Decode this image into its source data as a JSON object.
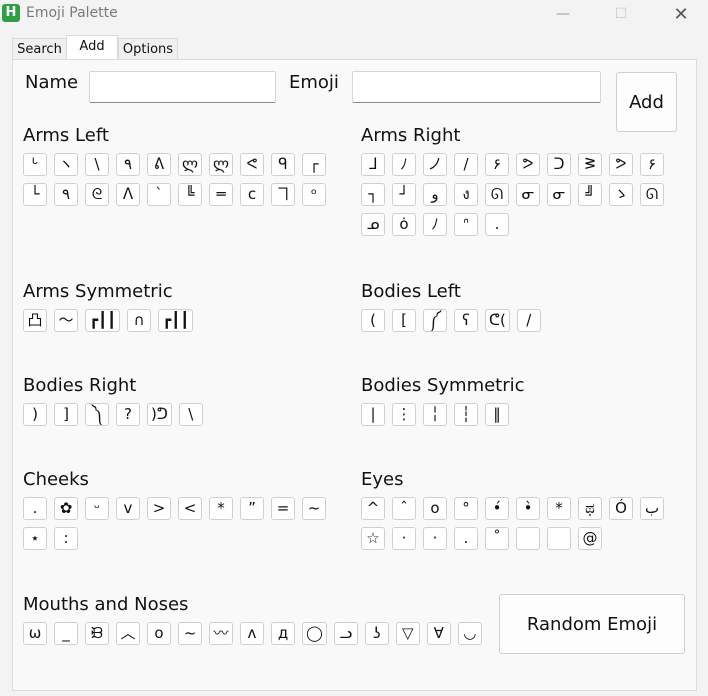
{
  "window": {
    "title": "Emoji Palette",
    "controls": {
      "minimize": "—",
      "maximize": "☐",
      "close": "✕"
    }
  },
  "tabs": [
    "Search",
    "Add",
    "Options"
  ],
  "add_form": {
    "name_label": "Name",
    "emoji_label": "Emoji",
    "name_value": "",
    "emoji_value": "",
    "add_button": "Add"
  },
  "random_button": "Random Emoji",
  "sections": [
    {
      "title": "Arms Left",
      "items": [
        "ᒡ",
        "ヽ",
        "\\",
        "٩",
        "ᕕ",
        "ლ",
        "ლ",
        "ᕙ",
        "ᑫ",
        "┌",
        "└",
        "٩",
        "ᘓ",
        "ᐱ",
        "ˋ",
        "╚",
        "═",
        "c",
        "ヿ",
        "ᵒ"
      ]
    },
    {
      "title": "Arms Right",
      "items": [
        "ᒧ",
        "ﾉ",
        "ノ",
        "/",
        "۶",
        "ᕗ",
        "ᑐ",
        "ᕒ",
        "ᕗ",
        "۶",
        "┐",
        "┘",
        "و",
        "ง",
        "ᘏ",
        "ᓂ",
        "ᓂ",
        "╝",
        "ゝ",
        "ᘏ",
        "ᓄ",
        "ȯ",
        "ﾉ",
        "ᐢ",
        "."
      ]
    },
    {
      "title": "Arms Symmetric",
      "items": [
        "凸",
        "〜",
        "┏┃┃",
        "∩",
        "┏┃┃"
      ]
    },
    {
      "title": "Bodies Left",
      "items": [
        "(",
        "[",
        "༼",
        "ʕ",
        "ᕦ(",
        "/"
      ]
    },
    {
      "title": "Bodies Right",
      "items": [
        ")",
        "]",
        "༽",
        "?",
        ")ᕤ",
        "\\"
      ]
    },
    {
      "title": "Bodies Symmetric",
      "items": [
        "|",
        "⋮",
        "╎",
        "┆",
        "‖"
      ]
    },
    {
      "title": "Cheeks",
      "items": [
        ".",
        "✿",
        "ᵕ",
        "v",
        ">",
        "<",
        "*",
        "”",
        "=",
        "~",
        "⋆",
        ":"
      ]
    },
    {
      "title": "Eyes",
      "items": [
        "^",
        "ˆ",
        "o",
        "°",
        "•́",
        "•̀",
        "*",
        "ಥ",
        "Ó",
        "ب",
        "☆",
        "·",
        "·",
        ".",
        "˚",
        " ",
        " ",
        "@"
      ]
    },
    {
      "title": "Mouths and Noses",
      "items": [
        "ω",
        "_",
        "ᙝ",
        "︿",
        "o",
        "~",
        "〰",
        "ʌ",
        "д",
        "◯",
        "ᓗ",
        "ʖ",
        "▽",
        "∀",
        "◡"
      ]
    }
  ]
}
